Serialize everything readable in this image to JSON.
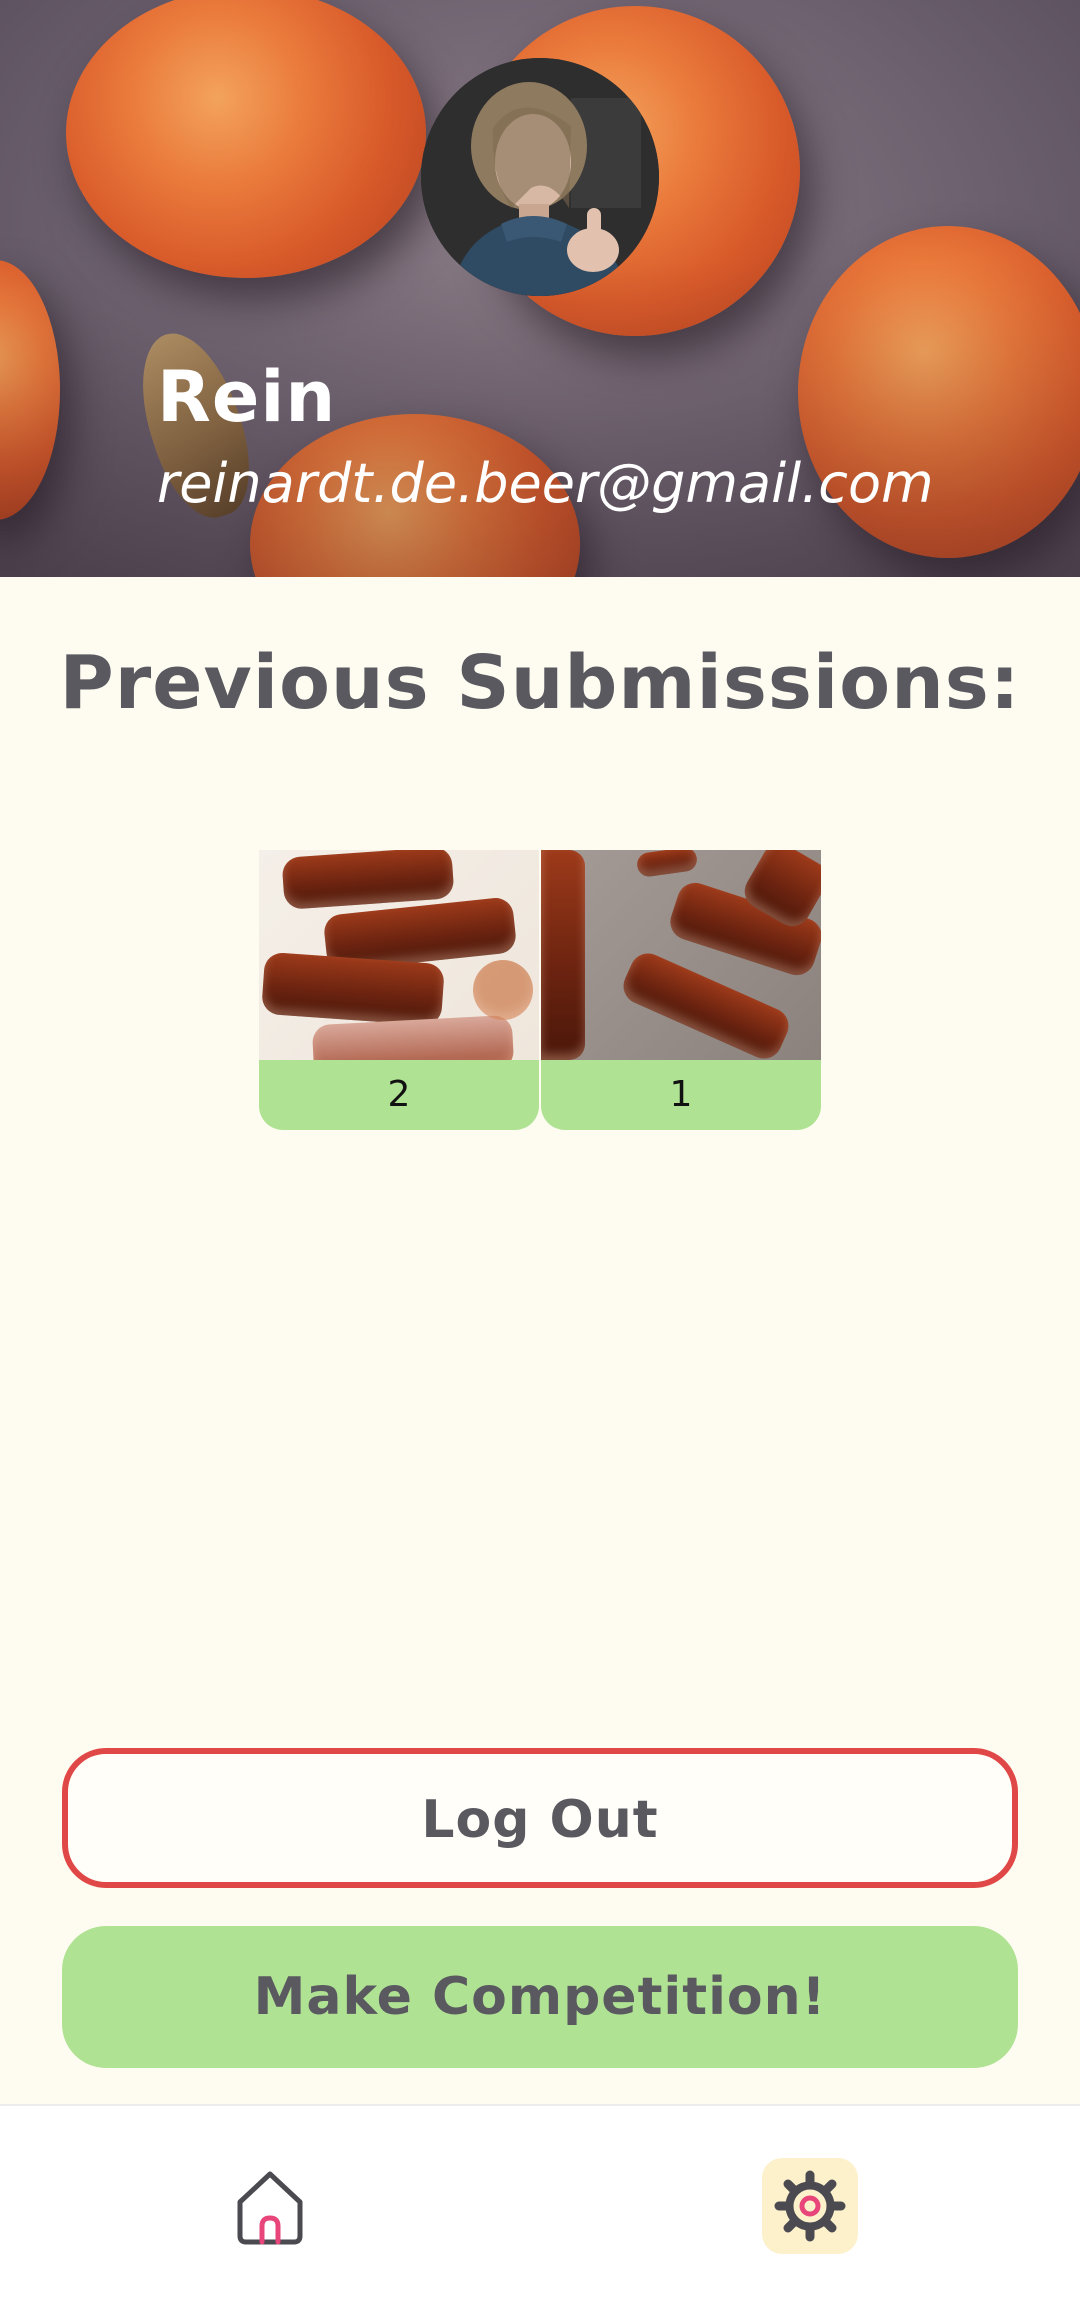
{
  "profile": {
    "name": "Rein",
    "email": "reinardt.de.beer@gmail.com",
    "avatar_icon": "user-photo"
  },
  "submissions": {
    "title": "Previous Submissions:",
    "items": [
      {
        "label": "2"
      },
      {
        "label": "1"
      }
    ]
  },
  "actions": {
    "logout_label": "Log Out",
    "make_competition_label": "Make Competition!"
  },
  "nav": {
    "items": [
      {
        "icon": "home-icon",
        "active": false
      },
      {
        "icon": "gear-icon",
        "active": true
      }
    ]
  },
  "colors": {
    "background": "#fefcf0",
    "accent_green": "#b0e294",
    "logout_border": "#e04848",
    "title_text": "#5a5960",
    "active_nav_bg": "#fdf1cc",
    "icon_pink": "#e8457a"
  }
}
